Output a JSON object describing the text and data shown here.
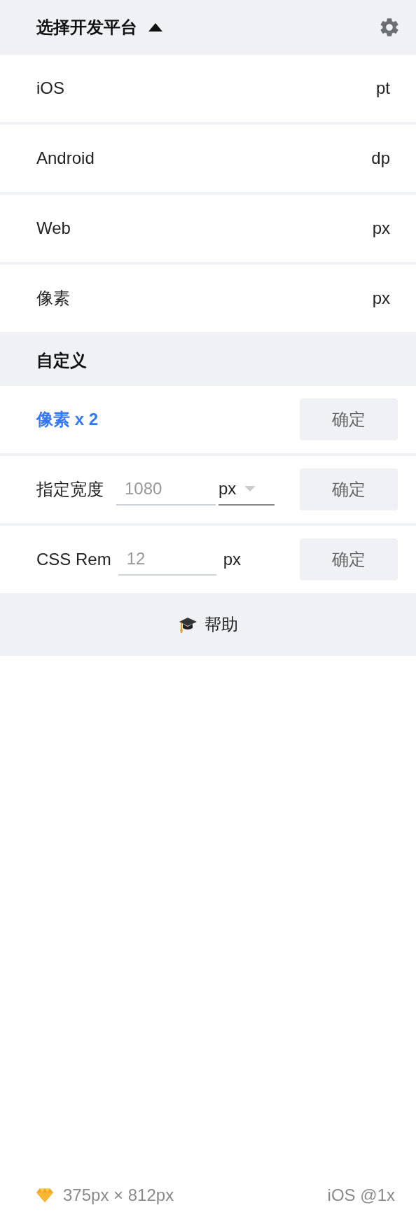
{
  "header": {
    "title": "选择开发平台",
    "expanded": true
  },
  "platforms": [
    {
      "name": "iOS",
      "unit": "pt",
      "selected": false
    },
    {
      "name": "Android",
      "unit": "dp",
      "selected": false
    },
    {
      "name": "Web",
      "unit": "px",
      "selected": false
    },
    {
      "name": "像素",
      "unit": "px",
      "selected": false
    }
  ],
  "custom": {
    "title": "自定义",
    "options": [
      {
        "kind": "preset",
        "label": "像素 x 2",
        "selected": true,
        "button": "确定"
      },
      {
        "kind": "width",
        "label": "指定宽度",
        "value": "1080",
        "unit": "px",
        "selected": false,
        "button": "确定"
      },
      {
        "kind": "rem",
        "label": "CSS Rem",
        "value": "12",
        "unit": "px",
        "selected": false,
        "button": "确定"
      }
    ]
  },
  "help": {
    "label": "帮助"
  },
  "status_bar": {
    "size": "375px × 812px",
    "platform": "iOS @1x"
  }
}
